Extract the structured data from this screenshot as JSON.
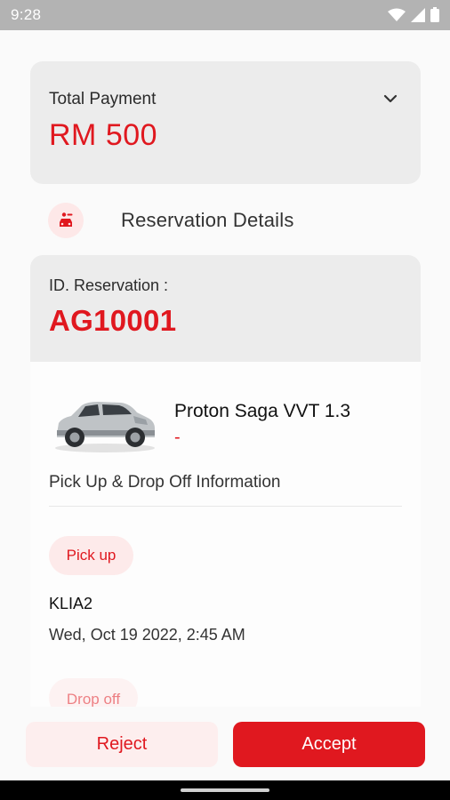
{
  "status_bar": {
    "time": "9:28",
    "icons": [
      "wifi-icon",
      "signal-icon",
      "battery-icon"
    ]
  },
  "payment": {
    "label": "Total Payment",
    "amount": "RM 500",
    "toggle_icon": "chevron-down-icon"
  },
  "reservation_section": {
    "icon": "car-user-icon",
    "title": "Reservation Details"
  },
  "reservation": {
    "id_label": "ID. Reservation :",
    "id_value": "AG10001",
    "car_name": "Proton Saga VVT 1.3",
    "car_subtitle": "-",
    "info_title": "Pick Up & Drop Off Information",
    "pickup": {
      "label": "Pick up",
      "location": "KLIA2",
      "datetime": "Wed, Oct 19 2022, 2:45 AM"
    },
    "dropoff": {
      "label": "Drop off"
    }
  },
  "actions": {
    "reject_label": "Reject",
    "accept_label": "Accept"
  },
  "colors": {
    "accent": "#e0181f",
    "accent_light": "#fdeaea",
    "card": "#ececec"
  }
}
